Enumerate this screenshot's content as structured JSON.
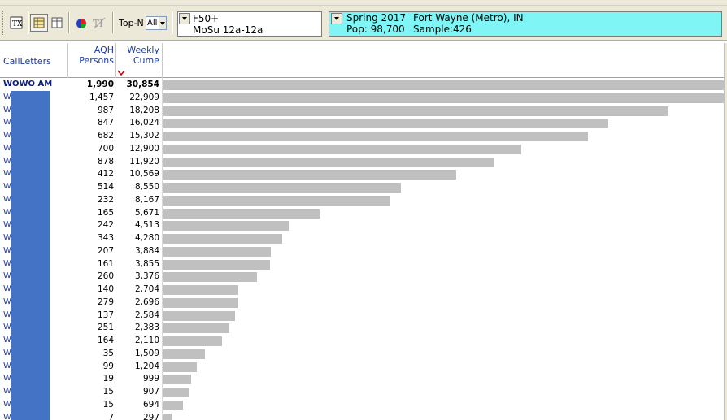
{
  "toolbar": {
    "topn_label": "Top-N",
    "topn_value": "All",
    "demo_line1": "F50+",
    "demo_line2": "MoSu 12a-12a",
    "market_survey": "Spring 2017",
    "market_name": "Fort Wayne (Metro), IN",
    "market_pop": "Pop: 98,700",
    "market_sample": "Sample:426",
    "market_color": "#7ff5f5",
    "icons": [
      "text-report-icon",
      "grid-view-icon",
      "table-view-icon",
      "pie-chart-icon",
      "ti-icon"
    ]
  },
  "header": {
    "callletters": "CallLetters",
    "aqh_line1": "AQH",
    "aqh_line2": "Persons",
    "cume_line1": "Weekly",
    "cume_line2": "Cume"
  },
  "rows": [
    {
      "call": "WOWO AM",
      "aqh": "1,990",
      "cume": "30,854",
      "cume_value": 30854,
      "bold": true
    },
    {
      "call": "WI",
      "aqh": "1,457",
      "cume": "22,909",
      "cume_value": 22909
    },
    {
      "call": "WI",
      "aqh": "987",
      "cume": "18,208",
      "cume_value": 18208
    },
    {
      "call": "WO",
      "aqh": "847",
      "cume": "16,024",
      "cume_value": 16024
    },
    {
      "call": "WI",
      "aqh": "682",
      "cume": "15,302",
      "cume_value": 15302
    },
    {
      "call": "WI",
      "aqh": "700",
      "cume": "12,900",
      "cume_value": 12900
    },
    {
      "call": "WI",
      "aqh": "878",
      "cume": "11,920",
      "cume_value": 11920
    },
    {
      "call": "WA",
      "aqh": "412",
      "cume": "10,569",
      "cume_value": 10569
    },
    {
      "call": "WZ",
      "aqh": "514",
      "cume": "8,550",
      "cume_value": 8550
    },
    {
      "call": "WI",
      "aqh": "232",
      "cume": "8,167",
      "cume_value": 8167
    },
    {
      "call": "WI",
      "aqh": "165",
      "cume": "5,671",
      "cume_value": 5671
    },
    {
      "call": "WI",
      "aqh": "242",
      "cume": "4,513",
      "cume_value": 4513
    },
    {
      "call": "WI",
      "aqh": "343",
      "cume": "4,280",
      "cume_value": 4280
    },
    {
      "call": "WI",
      "aqh": "207",
      "cume": "3,884",
      "cume_value": 3884
    },
    {
      "call": "WI",
      "aqh": "161",
      "cume": "3,855",
      "cume_value": 3855
    },
    {
      "call": "WI",
      "aqh": "260",
      "cume": "3,376",
      "cume_value": 3376
    },
    {
      "call": "WI",
      "aqh": "140",
      "cume": "2,704",
      "cume_value": 2704
    },
    {
      "call": "WJ",
      "aqh": "279",
      "cume": "2,696",
      "cume_value": 2696
    },
    {
      "call": "WY",
      "aqh": "137",
      "cume": "2,584",
      "cume_value": 2584
    },
    {
      "call": "WZ",
      "aqh": "251",
      "cume": "2,383",
      "cume_value": 2383
    },
    {
      "call": "WJ",
      "aqh": "164",
      "cume": "2,110",
      "cume_value": 2110
    },
    {
      "call": "WI",
      "aqh": "35",
      "cume": "1,509",
      "cume_value": 1509
    },
    {
      "call": "WI",
      "aqh": "99",
      "cume": "1,204",
      "cume_value": 1204
    },
    {
      "call": "WI",
      "aqh": "19",
      "cume": "999",
      "cume_value": 999
    },
    {
      "call": "WI",
      "aqh": "15",
      "cume": "907",
      "cume_value": 907
    },
    {
      "call": "WI",
      "aqh": "15",
      "cume": "694",
      "cume_value": 694
    },
    {
      "call": "WI",
      "aqh": "7",
      "cume": "297",
      "cume_value": 297
    }
  ],
  "bar_scale_max": 20200
}
